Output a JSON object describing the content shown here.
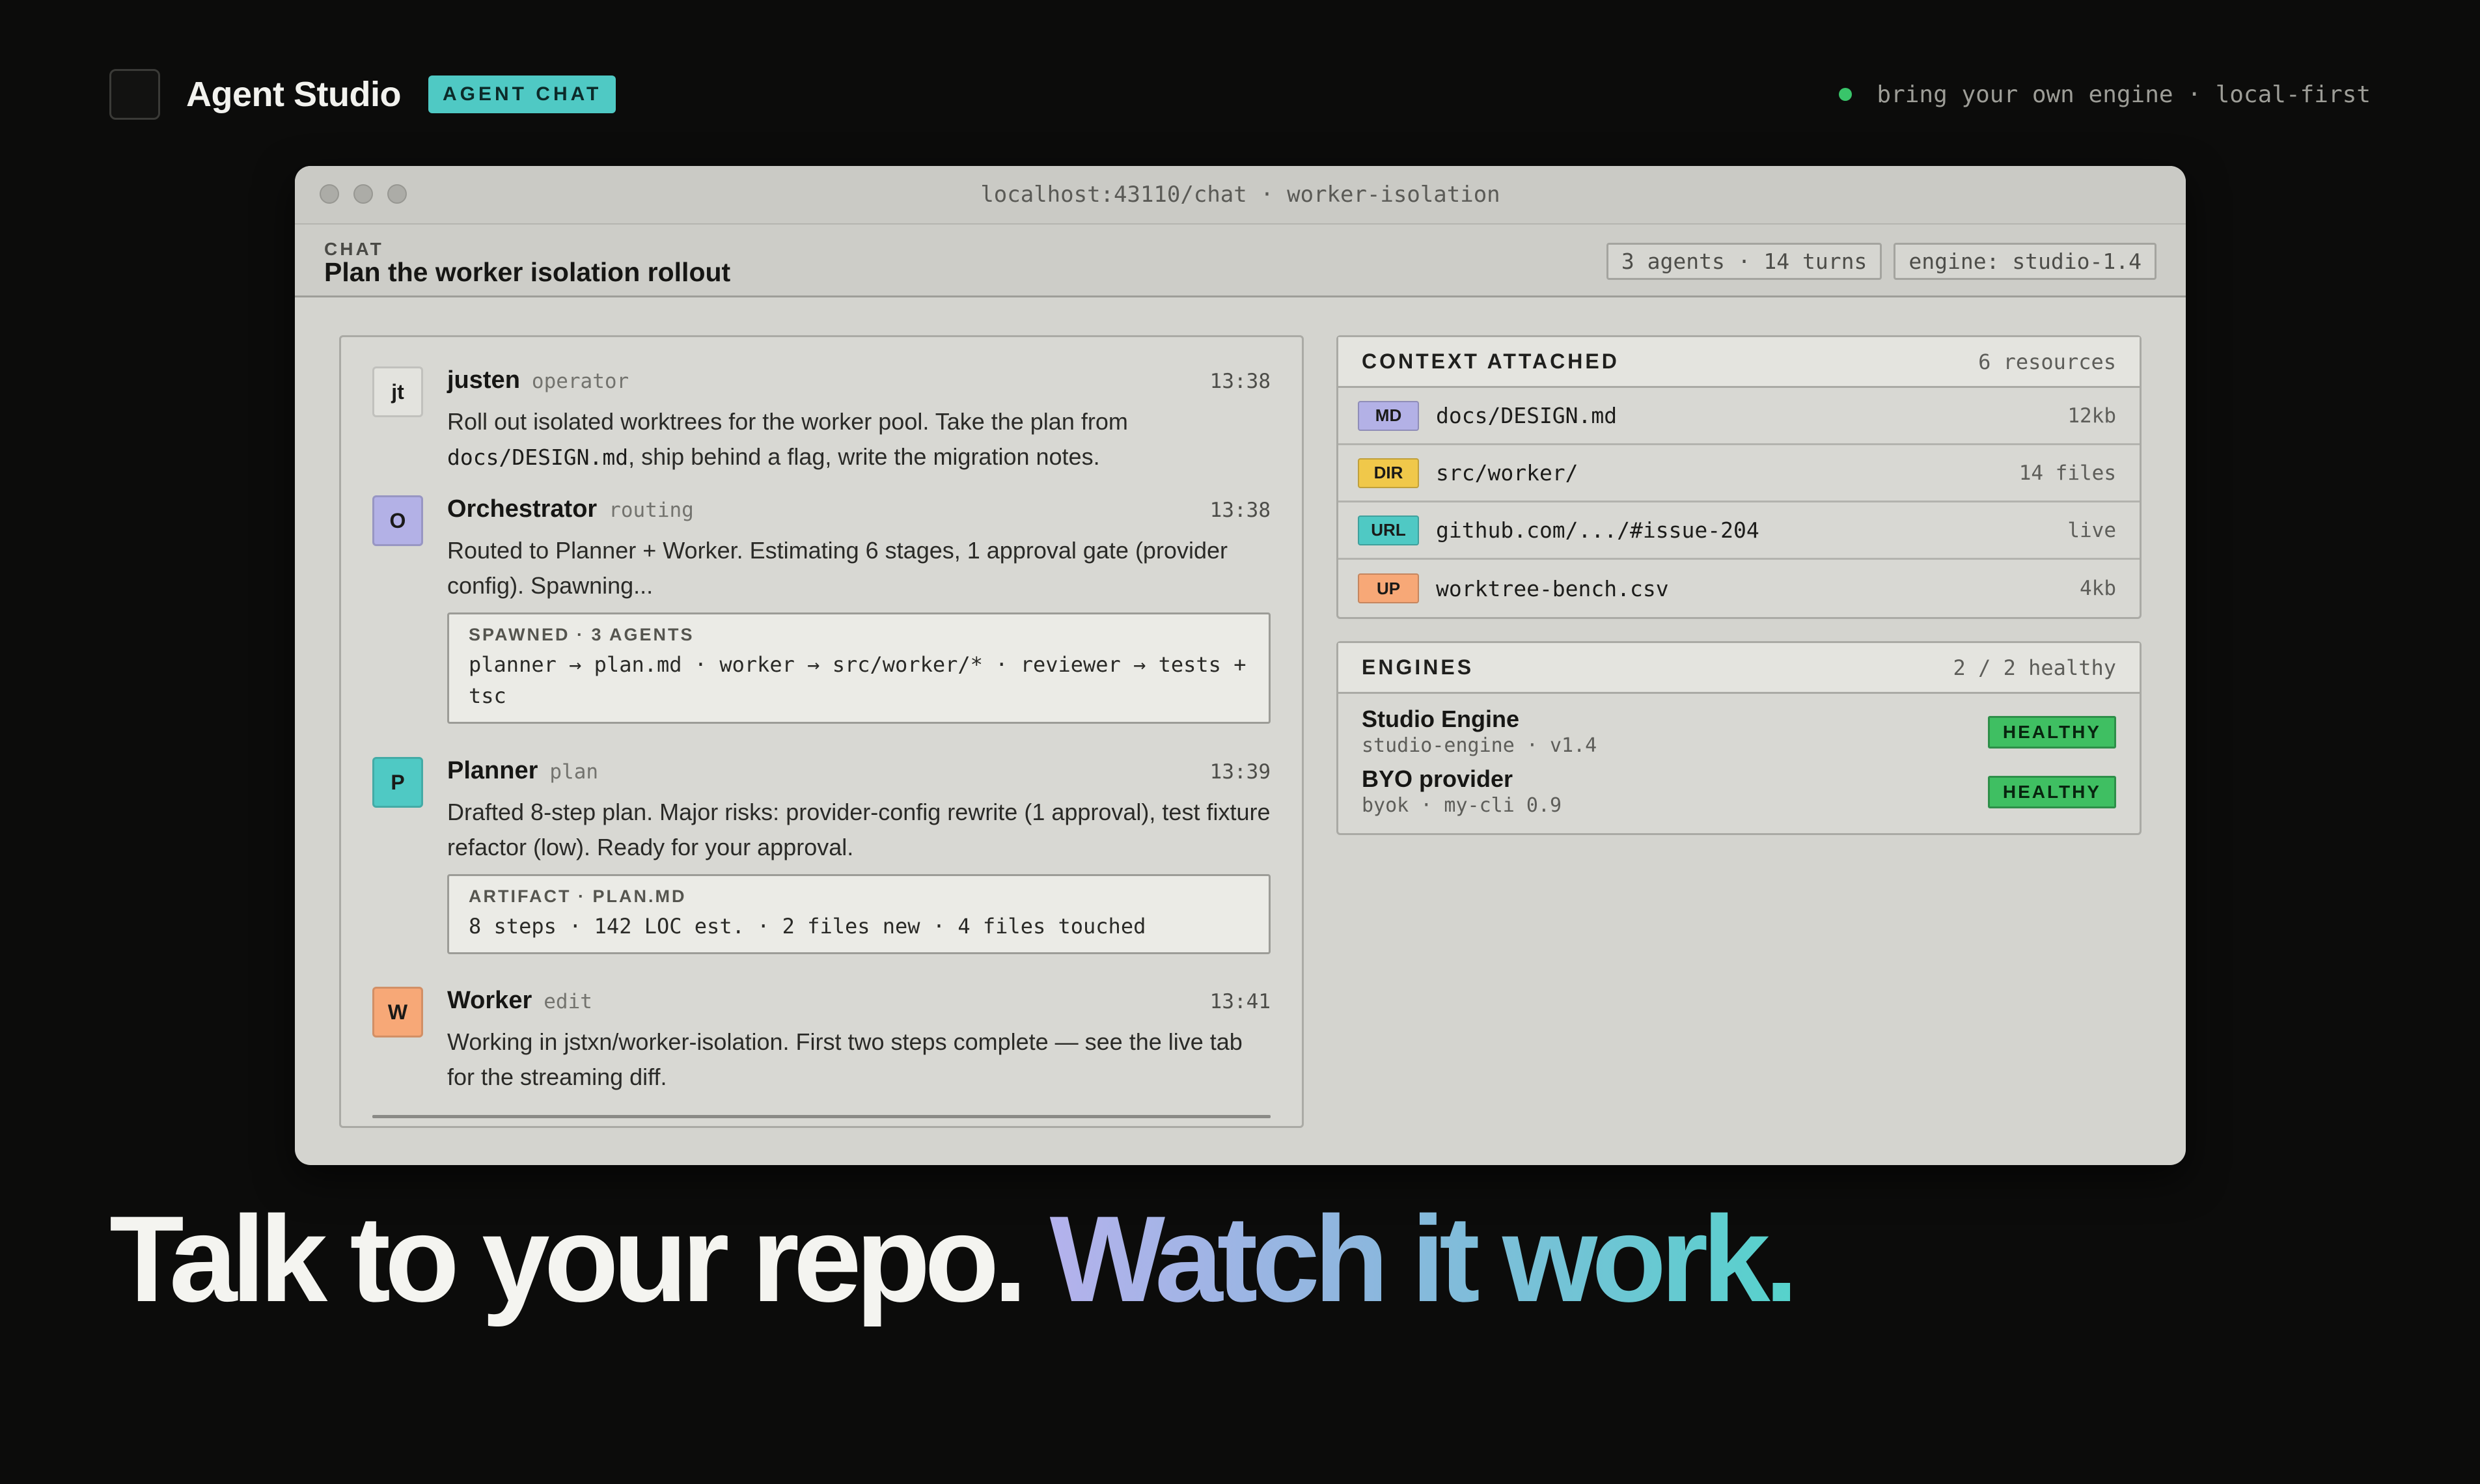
{
  "brand": {
    "name": "Agent Studio",
    "badge": "AGENT CHAT",
    "tagline": "bring your own engine · local-first"
  },
  "window": {
    "url": "localhost:43110/chat · worker-isolation"
  },
  "chat": {
    "label": "CHAT",
    "title": "Plan the worker isolation rollout",
    "chips": [
      "3 agents · 14 turns",
      "engine: studio-1.4"
    ]
  },
  "messages": [
    {
      "avatar": "jt",
      "avatar_color": "#e3e3de",
      "name": "justen",
      "role": "operator",
      "time": "13:38",
      "body_1": "Roll out isolated worktrees for the worker pool. Take the plan from",
      "body_code": "docs/DESIGN.md",
      "body_2": ", ship behind a flag, write the migration notes."
    },
    {
      "avatar": "O",
      "avatar_color": "#b3b1e6",
      "name": "Orchestrator",
      "role": "routing",
      "time": "13:38",
      "body": "Routed to Planner + Worker. Estimating 6 stages, 1 approval gate (provider config). Spawning...",
      "card_title": "SPAWNED · 3 AGENTS",
      "card_text": "planner → plan.md · worker → src/worker/* · reviewer → tests + tsc"
    },
    {
      "avatar": "P",
      "avatar_color": "#4fc9c4",
      "name": "Planner",
      "role": "plan",
      "time": "13:39",
      "body": "Drafted 8-step plan. Major risks: provider-config rewrite (1 approval), test fixture refactor (low). Ready for your approval.",
      "card_title": "ARTIFACT · PLAN.MD",
      "card_text": "8 steps · 142 LOC est. · 2 files new · 4 files touched"
    },
    {
      "avatar": "W",
      "avatar_color": "#f7a877",
      "name": "Worker",
      "role": "edit",
      "time": "13:41",
      "body": "Working in jstxn/worker-isolation. First two steps complete — see the live tab for the streaming diff."
    }
  ],
  "context": {
    "title": "CONTEXT ATTACHED",
    "count": "6 resources",
    "items": [
      {
        "tag": "MD",
        "tag_color": "#b3b1e6",
        "name": "docs/DESIGN.md",
        "meta": "12kb"
      },
      {
        "tag": "DIR",
        "tag_color": "#f0c84a",
        "name": "src/worker/",
        "meta": "14 files"
      },
      {
        "tag": "URL",
        "tag_color": "#4fc9c4",
        "name": "github.com/.../#issue-204",
        "meta": "live"
      },
      {
        "tag": "UP",
        "tag_color": "#f7a877",
        "name": "worktree-bench.csv",
        "meta": "4kb"
      }
    ]
  },
  "engines": {
    "title": "ENGINES",
    "count": "2 / 2 healthy",
    "items": [
      {
        "name": "Studio Engine",
        "sub": "studio-engine · v1.4",
        "status": "HEALTHY"
      },
      {
        "name": "BYO provider",
        "sub": "byok · my-cli 0.9",
        "status": "HEALTHY"
      }
    ]
  },
  "headline": {
    "part1": "Talk to your repo. ",
    "part2": "Watch it work."
  },
  "colors": {
    "background": "#0c0c0b",
    "accent_teal": "#4fc9c4",
    "healthy_green": "#3fbf62"
  }
}
